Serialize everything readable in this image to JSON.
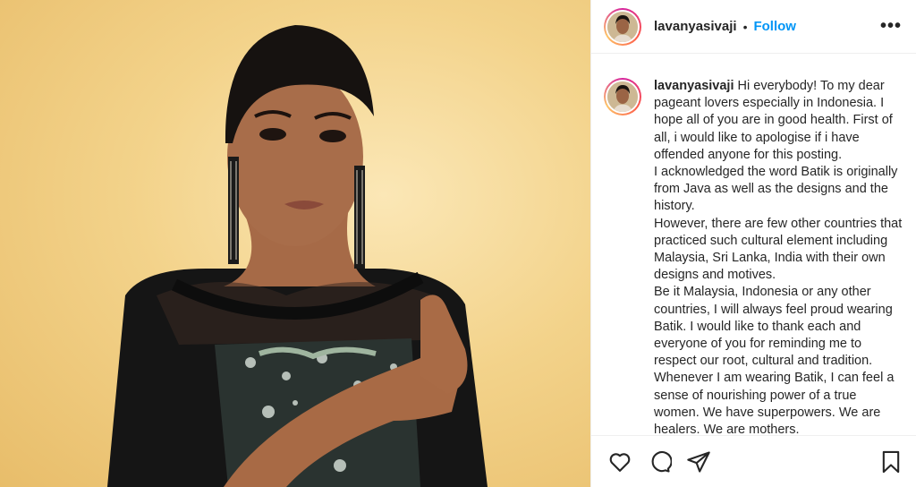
{
  "post": {
    "username": "lavanyasivaji",
    "separator": "•",
    "follow_label": "Follow",
    "more_icon": "more-horizontal-icon",
    "caption_paragraphs": [
      "Hi everybody! To my dear pageant lovers especially in Indonesia. I hope all of you are in good health. First of all, i would like to apologise if i have offended anyone for this posting.",
      "I acknowledged the word Batik is originally from Java as well as the designs and the history.",
      "However, there are few other countries that practiced such cultural element including Malaysia, Sri Lanka, India with their own designs and motives.",
      "Be it Malaysia, Indonesia or any other countries, I will always feel proud wearing Batik. I would like to thank each and everyone of you for reminding me to respect our root, cultural and tradition. Whenever I am wearing Batik, I can feel a sense of nourishing power of a true women. We have superpowers. We are healers. We are mothers."
    ],
    "actions": {
      "like_icon": "heart-icon",
      "comment_icon": "comment-icon",
      "share_icon": "share-icon",
      "save_icon": "bookmark-icon"
    }
  },
  "colors": {
    "follow": "#0095f6",
    "text": "#262626",
    "border": "#efefef"
  }
}
